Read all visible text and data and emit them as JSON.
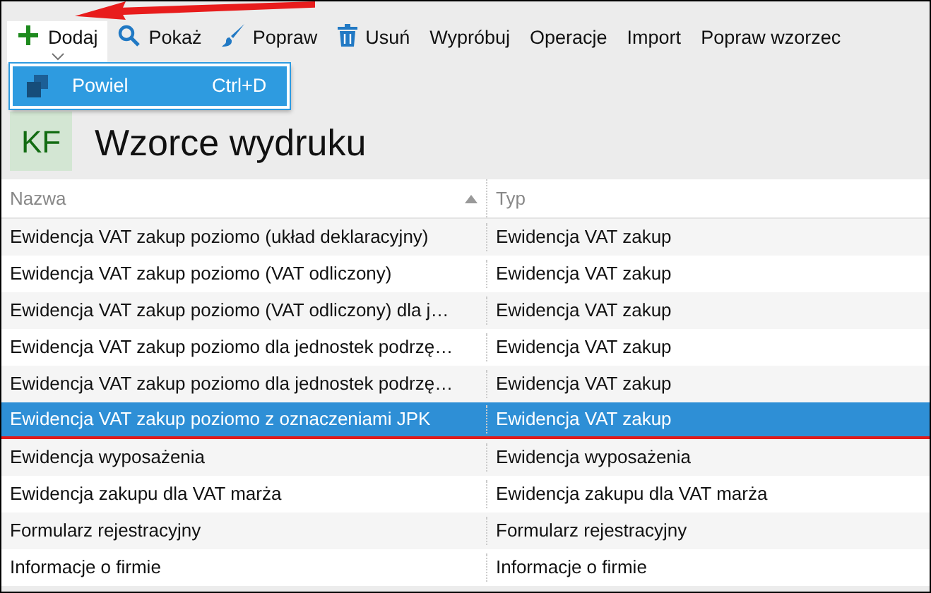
{
  "toolbar": [
    {
      "label": "Dodaj",
      "kind": "add",
      "expanded": true
    },
    {
      "label": "Pokaż",
      "kind": "show",
      "expanded": false
    },
    {
      "label": "Popraw",
      "kind": "edit",
      "expanded": false
    },
    {
      "label": "Usuń",
      "kind": "delete",
      "expanded": false
    },
    {
      "label": "Wypróbuj",
      "kind": "text",
      "expanded": false
    },
    {
      "label": "Operacje",
      "kind": "text",
      "expanded": false
    },
    {
      "label": "Import",
      "kind": "text",
      "expanded": false
    },
    {
      "label": "Popraw wzorzec",
      "kind": "text",
      "expanded": false
    }
  ],
  "dropdown_menu": [
    {
      "label": "Powiel",
      "shortcut": "Ctrl+D",
      "selected": true
    }
  ],
  "header": {
    "logo": "KF",
    "title": "Wzorce wydruku"
  },
  "table": {
    "columns": [
      {
        "label": "Nazwa",
        "sorted": true
      },
      {
        "label": "Typ",
        "sorted": false
      }
    ],
    "rows": [
      {
        "cells": [
          "Ewidencja VAT zakup poziomo (układ deklaracyjny)",
          "Ewidencja VAT zakup"
        ],
        "selected": false
      },
      {
        "cells": [
          "Ewidencja VAT zakup poziomo (VAT odliczony)",
          "Ewidencja VAT zakup"
        ],
        "selected": false
      },
      {
        "cells": [
          "Ewidencja VAT zakup poziomo (VAT odliczony) dla j…",
          "Ewidencja VAT zakup"
        ],
        "selected": false
      },
      {
        "cells": [
          "Ewidencja VAT zakup poziomo dla jednostek podrzę…",
          "Ewidencja VAT zakup"
        ],
        "selected": false
      },
      {
        "cells": [
          "Ewidencja VAT zakup poziomo dla jednostek podrzę…",
          "Ewidencja VAT zakup"
        ],
        "selected": false
      },
      {
        "cells": [
          "Ewidencja VAT zakup poziomo z oznaczeniami JPK",
          "Ewidencja VAT zakup"
        ],
        "selected": true
      },
      {
        "cells": [
          "Ewidencja wyposażenia",
          "Ewidencja wyposażenia"
        ],
        "selected": false
      },
      {
        "cells": [
          "Ewidencja zakupu dla VAT marża",
          "Ewidencja zakupu dla VAT marża"
        ],
        "selected": false
      },
      {
        "cells": [
          "Formularz rejestracyjny",
          "Formularz rejestracyjny"
        ],
        "selected": false
      },
      {
        "cells": [
          "Informacje o firmie",
          "Informacje o firmie"
        ],
        "selected": false
      }
    ]
  }
}
